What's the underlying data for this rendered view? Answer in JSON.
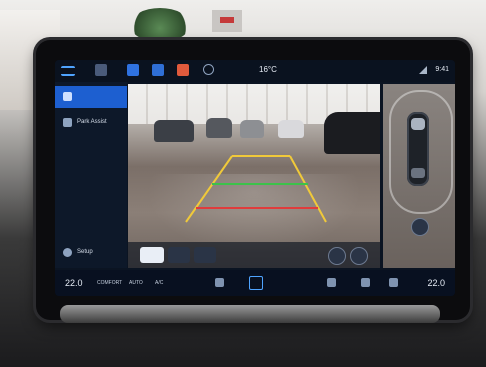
{
  "topbar": {
    "temperature": "16°C",
    "time": "9:41"
  },
  "sidebar": {
    "items": [
      {
        "label": ""
      },
      {
        "label": "Park Assist"
      }
    ],
    "bottom_label": "Setup"
  },
  "bottombar": {
    "left_temp": "22.0",
    "left_unit": "",
    "mode_label": "COMFORT",
    "auto_label": "AUTO",
    "ac_label": "A/C",
    "right_temp": "22.0",
    "right_unit": ""
  },
  "colors": {
    "accent": "#1d5fd0",
    "guide_near": "#e03c3c",
    "guide_mid": "#3cc24a",
    "guide_far": "#f0c93a"
  },
  "icons": [
    "menu-icon",
    "camera-app-icon",
    "navigation-icon",
    "music-icon",
    "app-icon",
    "add-icon",
    "signal-icon",
    "parking-icon",
    "park-assist-icon",
    "settings-icon",
    "home-icon",
    "seat-heat-icon",
    "fan-icon",
    "defrost-icon"
  ]
}
